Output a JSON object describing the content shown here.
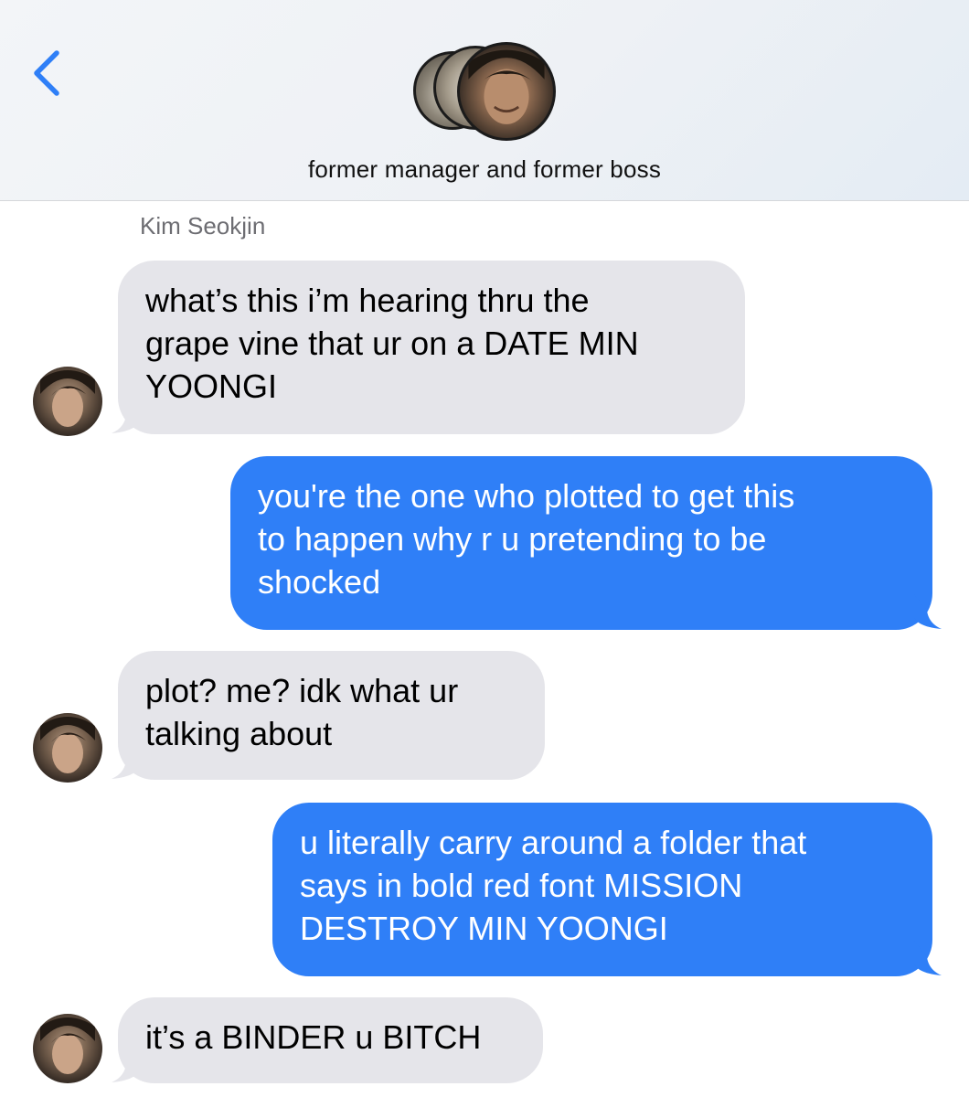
{
  "header": {
    "group_name": "former manager and former boss",
    "back_icon": "chevron-left-icon",
    "accent_color": "#2f7ff7"
  },
  "thread": {
    "sender_name": "Kim Seokjin",
    "messages": [
      {
        "direction": "incoming",
        "lines": [
          "what’s this i’m hearing thru the",
          "grape vine that ur on a DATE MIN",
          "YOONGI"
        ]
      },
      {
        "direction": "outgoing",
        "lines": [
          "you're the one who plotted to get this",
          "to happen why r u pretending to be",
          "shocked"
        ]
      },
      {
        "direction": "incoming",
        "lines": [
          "plot? me? idk what ur",
          "talking about"
        ]
      },
      {
        "direction": "outgoing",
        "lines": [
          "u literally carry around a folder that",
          "says in bold red font MISSION",
          "DESTROY MIN YOONGI"
        ]
      },
      {
        "direction": "incoming",
        "lines": [
          "it’s a BINDER u BITCH"
        ]
      }
    ]
  },
  "colors": {
    "incoming_bubble": "#e5e5ea",
    "outgoing_bubble": "#2f7ff7"
  }
}
